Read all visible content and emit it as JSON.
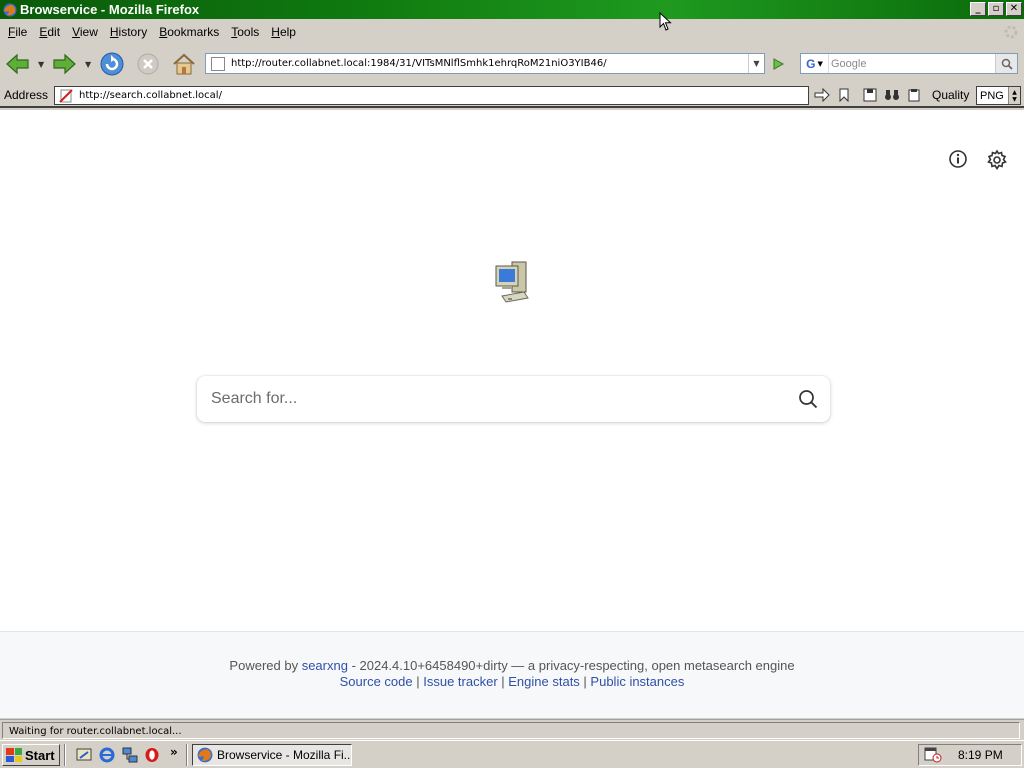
{
  "window": {
    "title": "Browservice - Mozilla Firefox",
    "buttons": {
      "minimize": "_",
      "maximize": "▫",
      "close": "✕"
    }
  },
  "menubar": {
    "items": [
      {
        "label": "File",
        "accel": "F",
        "rest": "ile"
      },
      {
        "label": "Edit",
        "accel": "E",
        "rest": "dit"
      },
      {
        "label": "View",
        "accel": "V",
        "rest": "iew"
      },
      {
        "label": "History",
        "accel": "H",
        "rest": "istory"
      },
      {
        "label": "Bookmarks",
        "accel": "B",
        "rest": "ookmarks"
      },
      {
        "label": "Tools",
        "accel": "T",
        "rest": "ools"
      },
      {
        "label": "Help",
        "accel": "H",
        "rest": "elp"
      }
    ]
  },
  "navbar": {
    "url": "http://router.collabnet.local:1984/31/VITsMNlflSmhk1ehrqRoM21niO3YIB46/",
    "search_engine_letter": "G",
    "search_placeholder": "Google"
  },
  "addressbar": {
    "label": "Address",
    "url": "http://search.collabnet.local/",
    "quality_label": "Quality",
    "quality_value": "PNG"
  },
  "page": {
    "search": {
      "placeholder": "Search for..."
    },
    "footer": {
      "powered_by": "Powered by",
      "searxng_link": "searxng",
      "version_text": " - 2024.4.10+6458490+dirty — a privacy-respecting, open metasearch engine",
      "links": [
        "Source code",
        "Issue tracker",
        "Engine stats",
        "Public instances"
      ],
      "separator": " | "
    }
  },
  "statusbar": {
    "text": "Waiting for router.collabnet.local..."
  },
  "taskbar": {
    "start_label": "Start",
    "task_label": "Browservice - Mozilla Fi...",
    "clock": "8:19 PM",
    "more_glyph": "»"
  },
  "colors": {
    "titlebar": "#0f7a0f",
    "link": "#3050a8",
    "chrome": "#d4d0c8"
  },
  "icons": [
    "back-icon",
    "forward-icon",
    "reload-icon",
    "stop-icon",
    "home-icon",
    "go-icon",
    "search-icon",
    "info-icon",
    "settings-icon"
  ]
}
